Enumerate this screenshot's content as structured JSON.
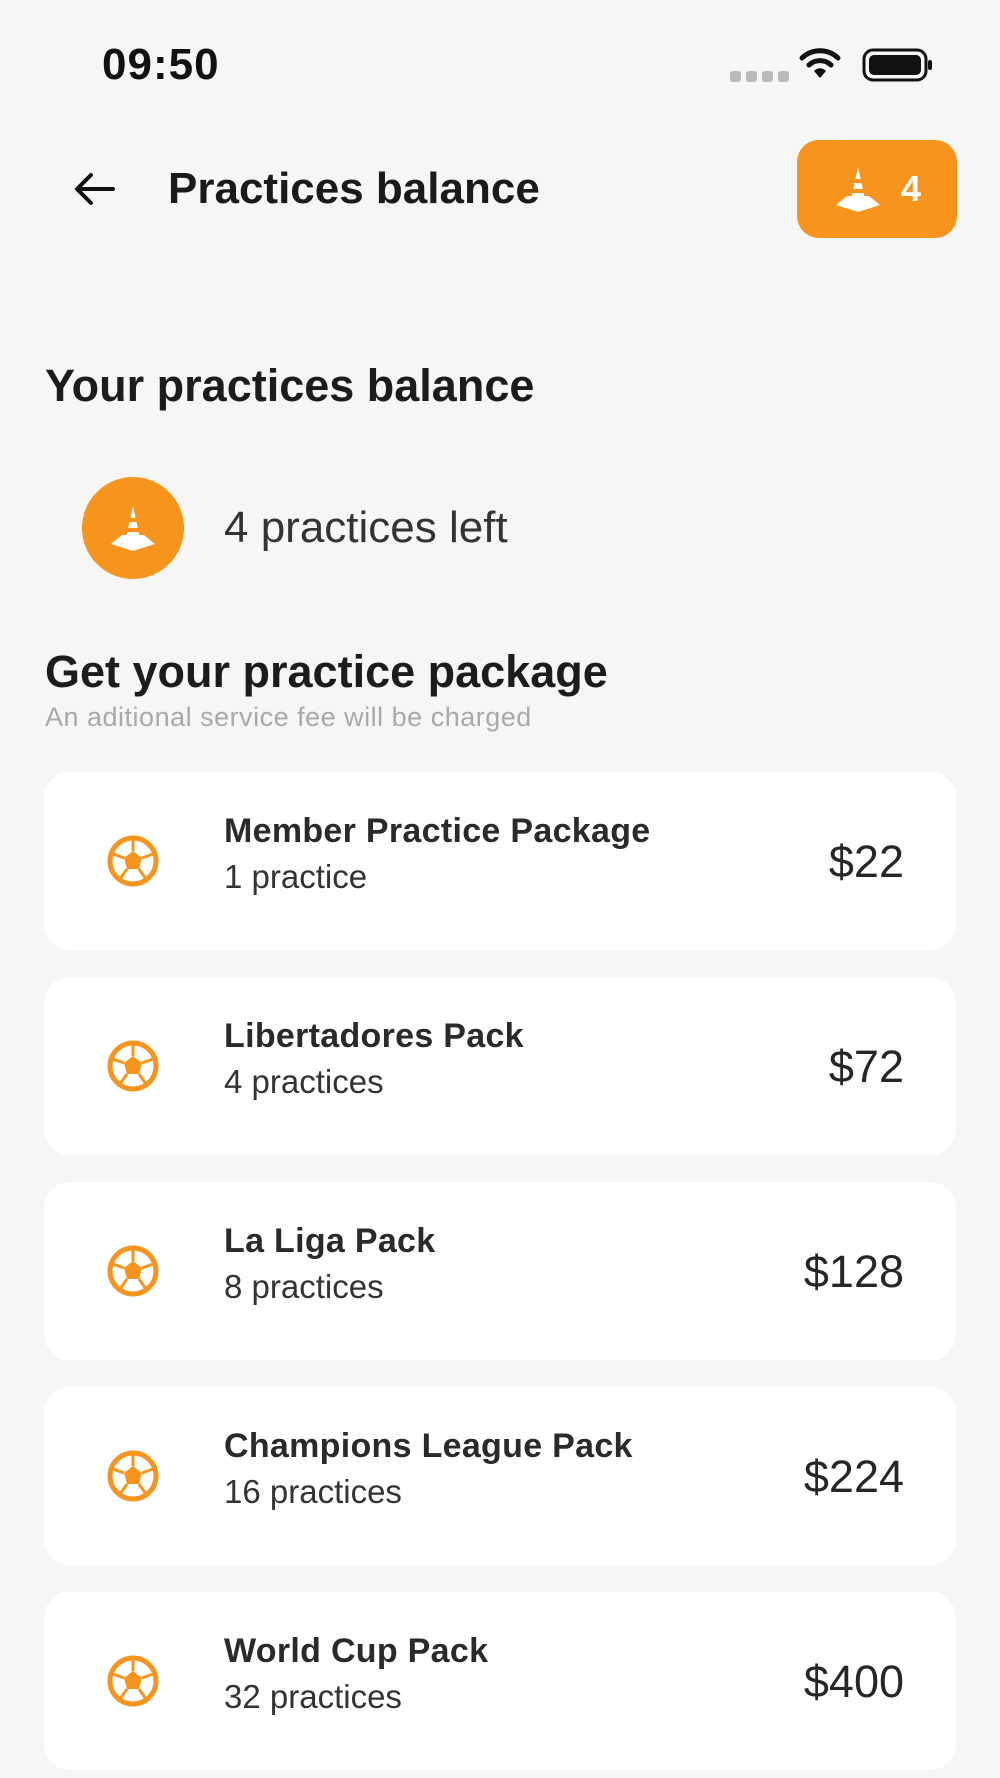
{
  "status_bar": {
    "time": "09:50"
  },
  "header": {
    "title": "Practices balance",
    "chip_count": "4"
  },
  "balance": {
    "title": "Your practices balance",
    "text": "4 practices left"
  },
  "packages": {
    "title": "Get your practice package",
    "subtitle": "An aditional service fee will be charged",
    "items": [
      {
        "name": "Member Practice Package",
        "count": "1 practice",
        "price": "$22"
      },
      {
        "name": "Libertadores Pack",
        "count": "4 practices",
        "price": "$72"
      },
      {
        "name": "La Liga Pack",
        "count": "8 practices",
        "price": "$128"
      },
      {
        "name": "Champions League Pack",
        "count": "16 practices",
        "price": "$224"
      },
      {
        "name": "World Cup Pack",
        "count": "32 practices",
        "price": "$400"
      }
    ]
  },
  "icons": {
    "back": "arrow-left-icon",
    "cone": "traffic-cone-icon",
    "ball": "soccer-ball-icon",
    "wifi": "wifi-icon",
    "battery": "battery-icon"
  },
  "colors": {
    "accent": "#f7941d",
    "background": "#f6f6f6",
    "card": "#ffffff"
  }
}
